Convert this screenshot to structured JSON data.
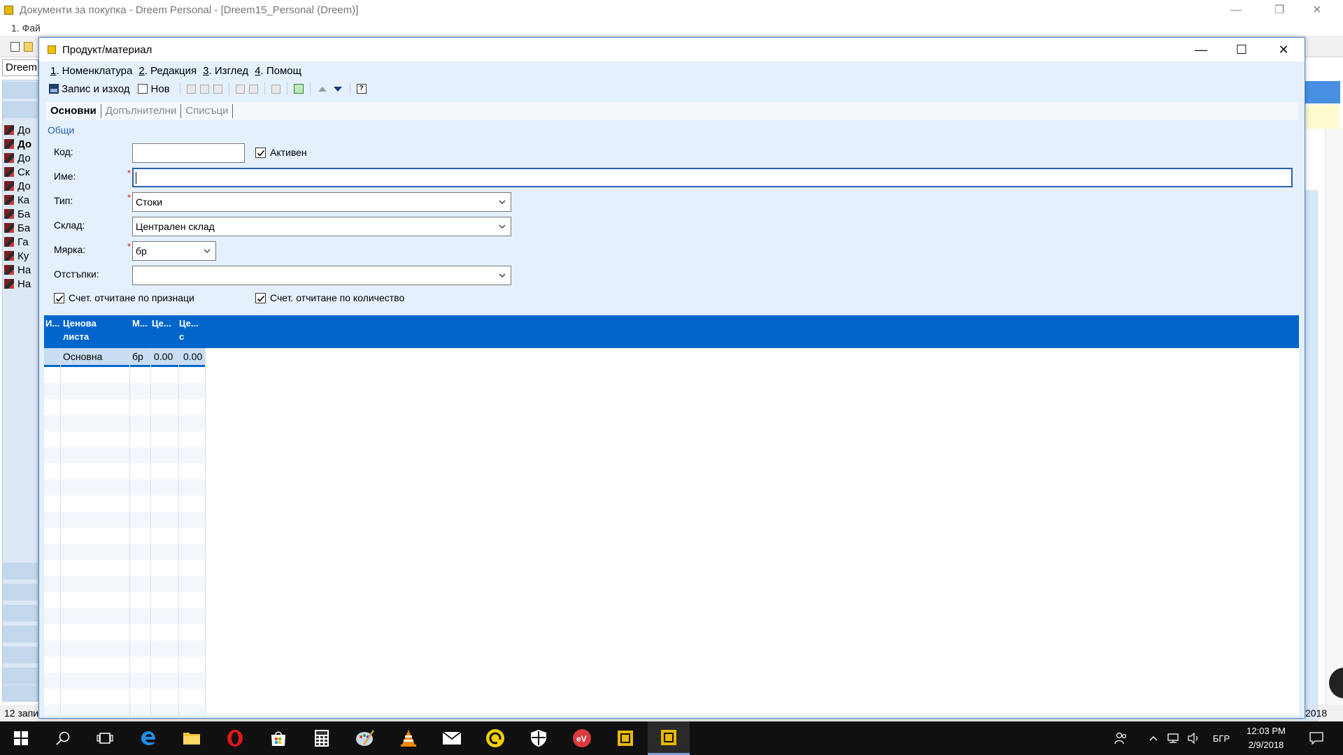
{
  "background_window": {
    "title": "Документи за покупка - Dreem Personal - [Dreem15_Personal (Dreem)]",
    "menu_fragment": "1. Фай",
    "combo_fragment": "Dreem",
    "list_items": [
      "До",
      "До",
      "До",
      "Ск",
      "До",
      "Ка",
      "Ба",
      "Ба",
      "Га",
      "Ку",
      "На",
      "На"
    ],
    "status_fragment": "12 запи",
    "date_fragment": "2018"
  },
  "dialog": {
    "title": "Продукт/материал",
    "menu": [
      {
        "num": "1",
        "label": ". Номенклатура"
      },
      {
        "num": "2",
        "label": ". Редакция"
      },
      {
        "num": "3",
        "label": ". Изглед"
      },
      {
        "num": "4",
        "label": ". Помощ"
      }
    ],
    "toolbar": {
      "save_exit": "Запис и изход",
      "new": "Нов"
    },
    "tabs": [
      "Основни",
      "Допълнителни",
      "Списъци"
    ],
    "group_label": "Общи",
    "form": {
      "code_label": "Код:",
      "code_value": "",
      "active_label": "Активен",
      "active_checked": true,
      "name_label": "Име:",
      "name_value": "",
      "type_label": "Тип:",
      "type_value": "Стоки",
      "warehouse_label": "Склад:",
      "warehouse_value": "Централен склад",
      "unit_label": "Мярка:",
      "unit_value": "бр",
      "discounts_label": "Отстъпки:",
      "discounts_value": "",
      "acct_by_attr_label": "Счет. отчитане по признаци",
      "acct_by_attr_checked": true,
      "acct_by_qty_label": "Счет. отчитане по количество",
      "acct_by_qty_checked": true
    },
    "grid": {
      "columns": [
        "И...",
        "Ценова листа",
        "М...",
        "Це...",
        "Це... с"
      ],
      "rows": [
        [
          "",
          "Основна",
          "бр",
          "0.00",
          "0.00"
        ]
      ]
    }
  },
  "taskbar": {
    "language": "БГР",
    "time": "12:03 PM",
    "date": "2/9/2018"
  }
}
